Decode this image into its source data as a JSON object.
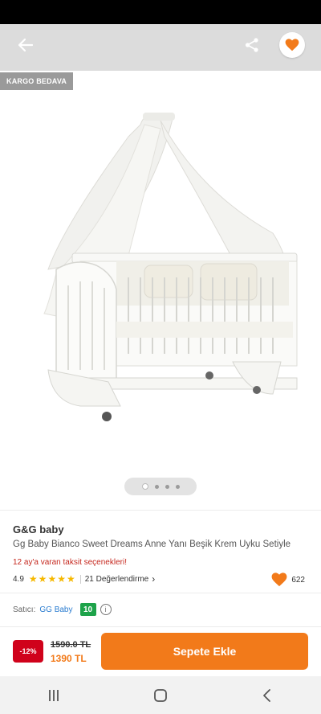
{
  "colors": {
    "accent": "#f27a1a",
    "discount": "#d0021b",
    "taksit": "#c5271d",
    "star": "#f6b800",
    "seller_score_bg": "#1ea34a",
    "seller_link": "#2a7cd0"
  },
  "header": {
    "back_icon": "arrow-left-icon",
    "share_icon": "share-icon",
    "favorite_icon": "heart-icon"
  },
  "gallery": {
    "shipping_badge": "KARGO BEDAVA",
    "image_subject": "crib-with-canopy",
    "page_count": 4,
    "current_page": 1
  },
  "product": {
    "brand": "G&G baby",
    "name": "Gg Baby Bianco Sweet Dreams Anne Yanı Beşik Krem Uyku Setiyle",
    "installment_text": "12 ay'a varan taksit seçenekleri!",
    "rating": "4.9",
    "rating_stars": 5,
    "review_text": "21 Değerlendirme",
    "favorite_count": "622"
  },
  "seller": {
    "label": "Satıcı:",
    "name": "GG Baby",
    "score": "10",
    "info_icon": "info-icon"
  },
  "purchase": {
    "discount": "-12%",
    "old_price": "1590.0 TL",
    "new_price": "1390 TL",
    "add_to_cart": "Sepete Ekle"
  },
  "navbar": {
    "recents_icon": "recents-icon",
    "home_icon": "home-icon",
    "back_icon": "back-chevron-icon"
  }
}
